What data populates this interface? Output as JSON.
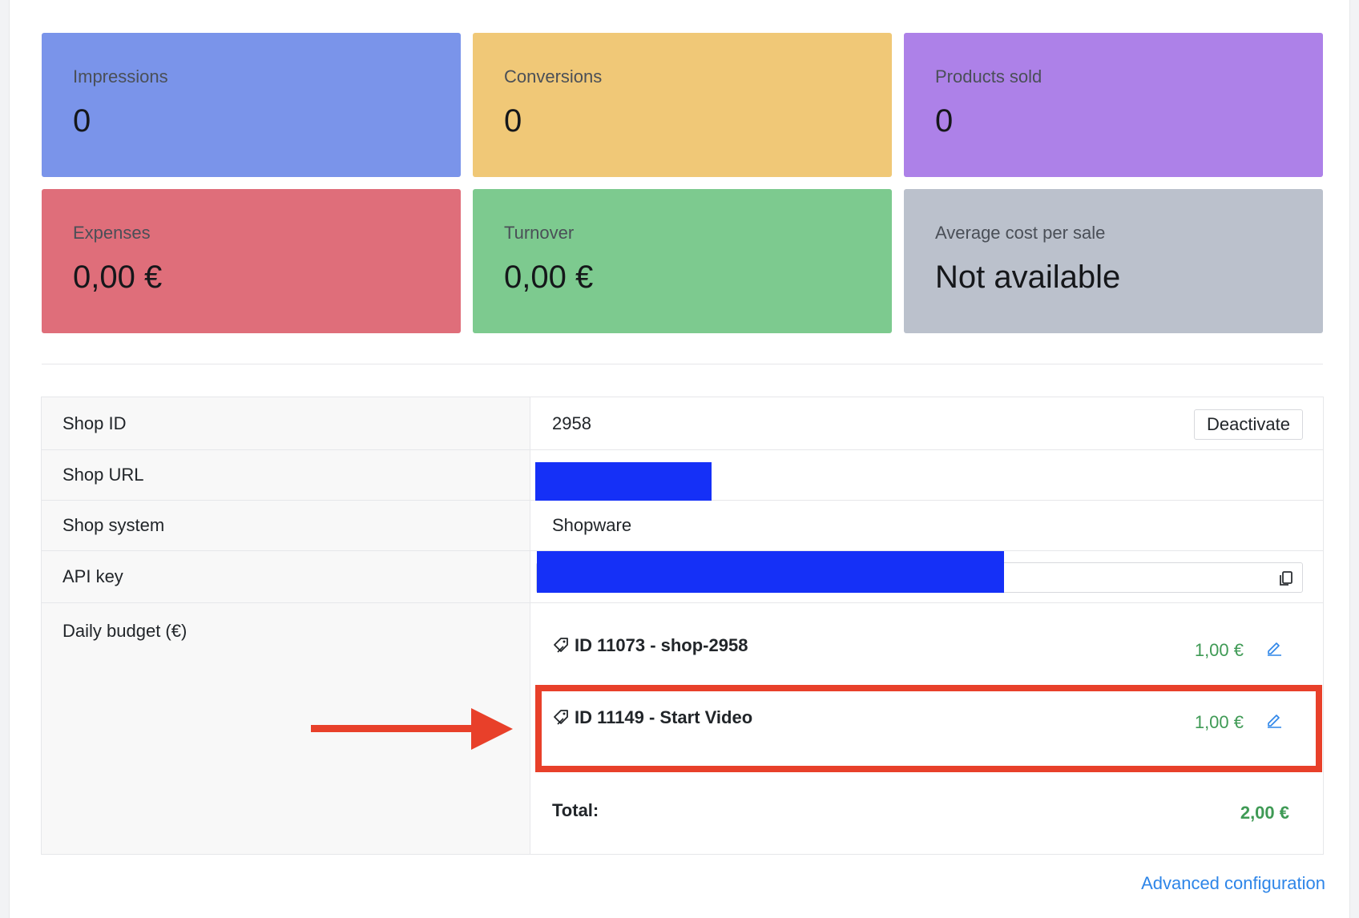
{
  "stats": [
    {
      "label": "Impressions",
      "value": "0",
      "color": "#7a94ea"
    },
    {
      "label": "Conversions",
      "value": "0",
      "color": "#f0c877"
    },
    {
      "label": "Products sold",
      "value": "0",
      "color": "#ad81e8"
    },
    {
      "label": "Expenses",
      "value": "0,00 €",
      "color": "#df6e7a"
    },
    {
      "label": "Turnover",
      "value": "0,00 €",
      "color": "#7dca8f"
    },
    {
      "label": "Average cost per sale",
      "value": "Not available",
      "color": "#bbc1cc"
    }
  ],
  "details": {
    "shop_id": {
      "label": "Shop ID",
      "value": "2958"
    },
    "deactivate_label": "Deactivate",
    "shop_url": {
      "label": "Shop URL"
    },
    "shop_system": {
      "label": "Shop system",
      "value": "Shopware"
    },
    "api_key": {
      "label": "API key"
    },
    "daily_budget": {
      "label": "Daily budget (€)",
      "campaigns": [
        {
          "name": "ID 11073 - shop-2958",
          "amount": "1,00 €"
        },
        {
          "name": "ID 11149 - Start Video",
          "amount": "1,00 €"
        }
      ],
      "total_label": "Total:",
      "total_value": "2,00 €"
    }
  },
  "advanced_link": "Advanced configuration",
  "colors": {
    "redaction": "#1530f7",
    "highlight": "#e8402a",
    "amount_green": "#3f9a55",
    "link_blue": "#2d85e8"
  },
  "icons": [
    "tag-icon",
    "copy-icon",
    "pencil-edit-icon",
    "arrow-annotation"
  ]
}
